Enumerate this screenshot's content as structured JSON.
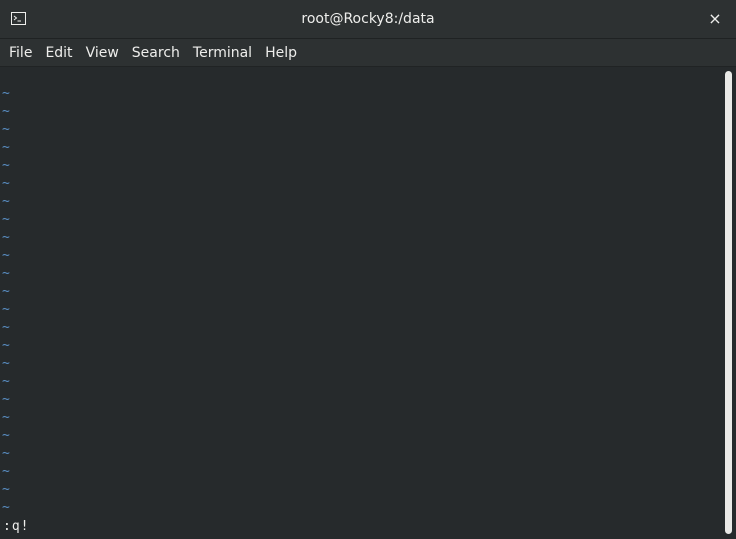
{
  "window": {
    "title": "root@Rocky8:/data",
    "close_label": "×"
  },
  "menubar": {
    "items": [
      "File",
      "Edit",
      "View",
      "Search",
      "Terminal",
      "Help"
    ]
  },
  "terminal": {
    "tilde_lines": [
      "~",
      "~",
      "~",
      "~",
      "~",
      "~",
      "~",
      "~",
      "~",
      "~",
      "~",
      "~",
      "~",
      "~",
      "~",
      "~",
      "~",
      "~",
      "~",
      "~",
      "~",
      "~",
      "~",
      "~"
    ],
    "command_line": ":q!"
  },
  "icons": {
    "app_icon": "terminal-icon",
    "close": "close-icon"
  },
  "colors": {
    "background": "#262a2c",
    "titlebar": "#2d3132",
    "tilde": "#5a8fc5",
    "text": "#eeeeec"
  }
}
